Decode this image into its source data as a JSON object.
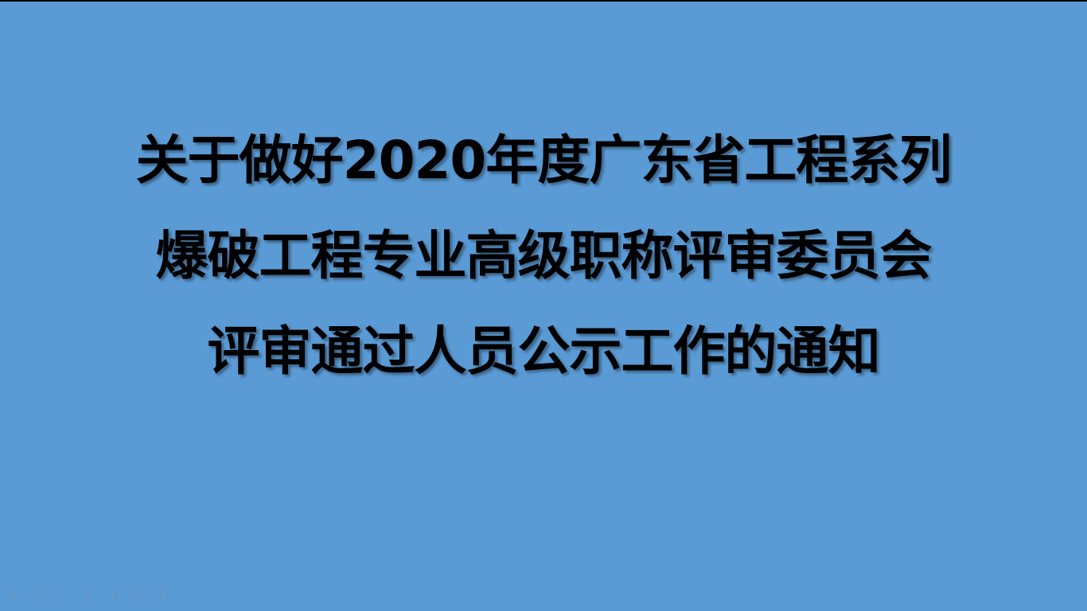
{
  "slide": {
    "background_color": "#5b9bd5",
    "text_color": "#000000",
    "title_lines": [
      "关于做好2020年度广东省工程系列",
      "爆破工程专业高级职称评审委员会",
      "评审通过人员公示工作的通知"
    ]
  },
  "toolbar": {
    "tools": [
      "pen-icon",
      "slides-grid-icon",
      "eraser-icon",
      "highlighter-icon",
      "pointer-icon",
      "camera-icon",
      "more-icon"
    ]
  }
}
